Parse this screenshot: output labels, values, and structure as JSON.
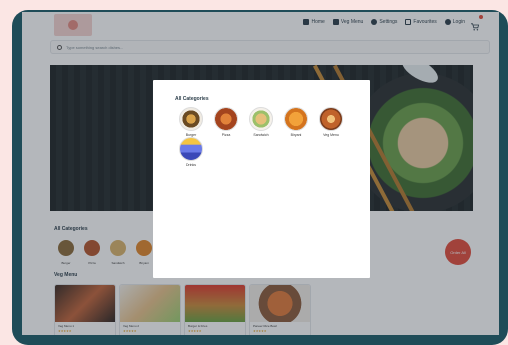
{
  "nav": {
    "items": [
      {
        "label": "Home",
        "icon": "home-icon"
      },
      {
        "label": "Veg Menu",
        "icon": "leaf-icon"
      },
      {
        "label": "Settings",
        "icon": "gear-icon"
      },
      {
        "label": "Favourites",
        "icon": "heart-icon"
      },
      {
        "label": "Login",
        "icon": "user-icon"
      }
    ],
    "cart_icon": "cart-icon"
  },
  "search": {
    "placeholder": "Type something search dishes..."
  },
  "page": {
    "categories_title": "All Categories",
    "categories": [
      "Burger",
      "Pizza",
      "Sandwich",
      "Biryani"
    ],
    "menu_title": "Veg Menu",
    "menu_items": [
      {
        "label": "Veg Menu 1",
        "stars": "★★★★★"
      },
      {
        "label": "Veg Menu 2",
        "stars": "★★★★★"
      },
      {
        "label": "Burger & Fries",
        "stars": "★★★★★"
      },
      {
        "label": "Paneer Rice Bowl",
        "stars": "★★★★★"
      }
    ],
    "fab_label": "Order All"
  },
  "modal": {
    "title": "All Categories",
    "categories": [
      {
        "label": "Burger",
        "color": "#8a6a3a"
      },
      {
        "label": "Pizza",
        "color": "#b4552c"
      },
      {
        "label": "Sandwich",
        "color": "#d9b36a"
      },
      {
        "label": "Biryani",
        "color": "#e0862a"
      },
      {
        "label": "Veg Menu",
        "color": "#b05a1e"
      },
      {
        "label": "Drinks",
        "color": "#4a5ad0"
      }
    ]
  },
  "colors": {
    "accent": "#e24c3b",
    "frame": "#1f4c58",
    "background": "#fbe6e4"
  }
}
